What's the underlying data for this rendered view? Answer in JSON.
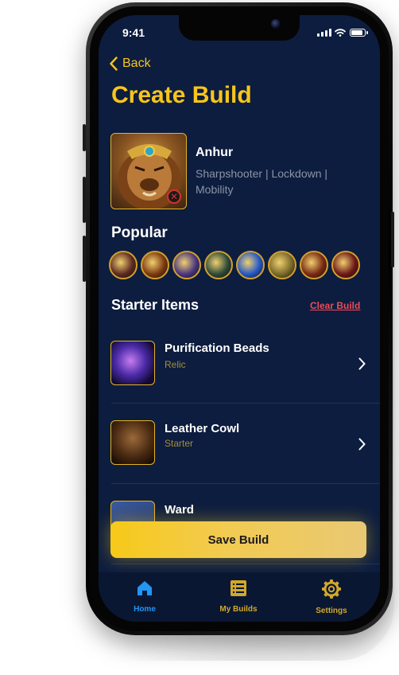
{
  "status": {
    "time": "9:41"
  },
  "header": {
    "back_label": "Back",
    "title": "Create Build"
  },
  "god": {
    "name": "Anhur",
    "tags": "Sharpshooter | Lockdown | Mobility",
    "portrait_icon": "anhur-portrait",
    "remove_icon": "remove-x-icon"
  },
  "popular": {
    "title": "Popular",
    "items": [
      {
        "icon": "popular-item-1-icon",
        "color": "#5d2a21"
      },
      {
        "icon": "popular-item-2-icon",
        "color": "#7d3a10"
      },
      {
        "icon": "popular-item-3-icon",
        "color": "#4a3680"
      },
      {
        "icon": "popular-item-4-icon",
        "color": "#2e4a3a"
      },
      {
        "icon": "popular-item-5-icon",
        "color": "#2458c9"
      },
      {
        "icon": "popular-item-6-icon",
        "color": "#7a6a2a"
      },
      {
        "icon": "popular-item-7-icon",
        "color": "#7a2a14"
      },
      {
        "icon": "popular-item-8-icon",
        "color": "#6e1818"
      }
    ]
  },
  "starter": {
    "title": "Starter Items",
    "clear_label": "Clear Build",
    "items": [
      {
        "name": "Purification Beads",
        "type": "Relic",
        "icon": "purification-beads-icon"
      },
      {
        "name": "Leather Cowl",
        "type": "Starter",
        "icon": "leather-cowl-icon"
      },
      {
        "name": "Ward",
        "type": "",
        "icon": "ward-icon"
      }
    ]
  },
  "save_label": "Save Build",
  "tabs": [
    {
      "label": "Home",
      "icon": "home-icon",
      "active": true
    },
    {
      "label": "My Builds",
      "icon": "list-icon",
      "active": false
    },
    {
      "label": "Settings",
      "icon": "gear-icon",
      "active": false
    }
  ],
  "colors": {
    "accent": "#f8c51b",
    "background": "#0d1d3f",
    "clear": "#ec4b59",
    "tab_active": "#2196f3",
    "tab_inactive": "#d2a82a"
  }
}
